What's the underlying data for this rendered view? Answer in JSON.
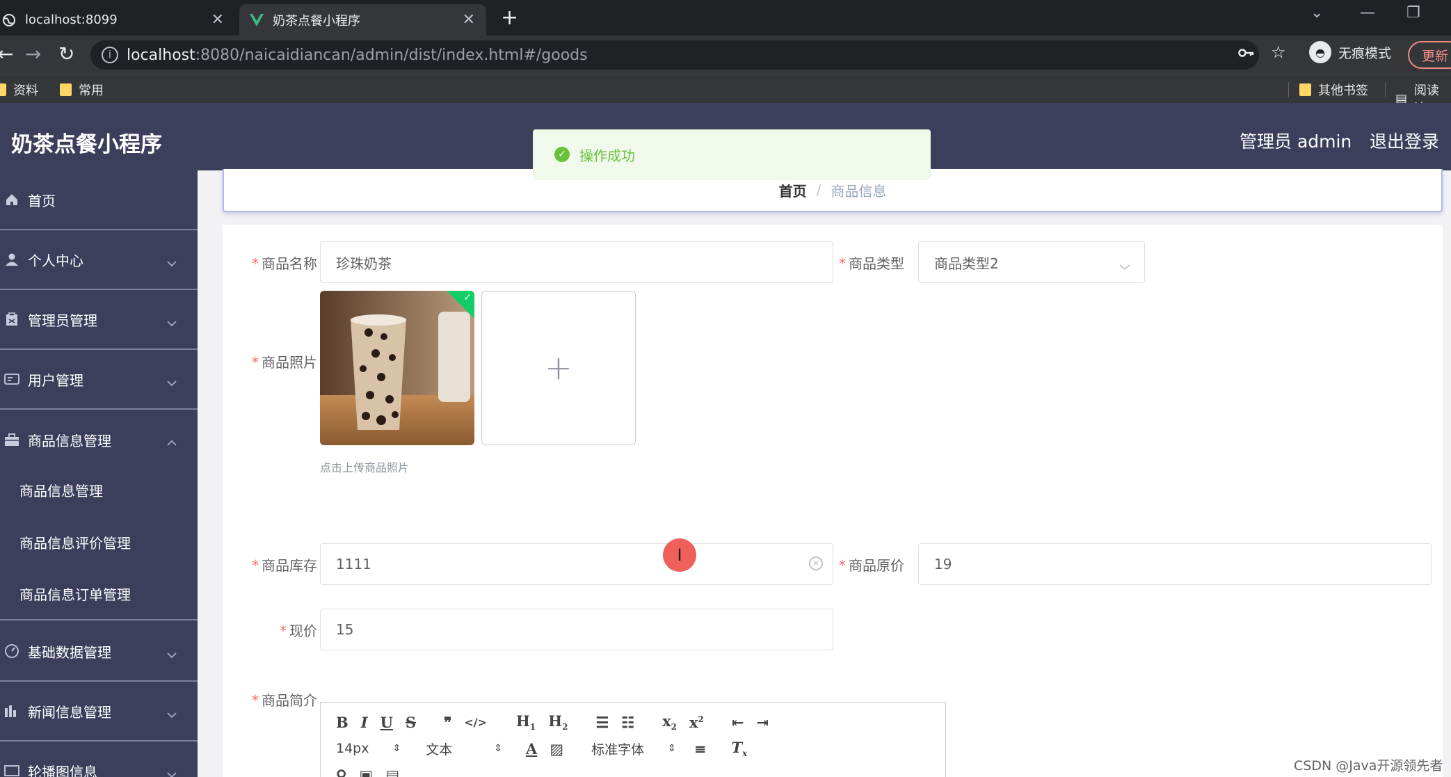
{
  "browser": {
    "tabs": [
      {
        "label": "localhost:8099"
      },
      {
        "label": "奶茶点餐小程序"
      }
    ],
    "url_host": "localhost",
    "url_path": ":8080/naicaidiancan/admin/dist/index.html#/goods",
    "incognito_label": "无痕模式",
    "update_label": "更新",
    "bookmarks": [
      "资料",
      "常用"
    ],
    "other_bookmarks": "其他书签",
    "reading_list": "阅读清"
  },
  "header": {
    "title": "奶茶点餐小程序",
    "admin_label": "管理员 admin",
    "logout_label": "退出登录"
  },
  "toast": {
    "message": "操作成功"
  },
  "sidebar": {
    "items": [
      {
        "label": "首页"
      },
      {
        "label": "个人中心"
      },
      {
        "label": "管理员管理"
      },
      {
        "label": "用户管理"
      },
      {
        "label": "商品信息管理"
      },
      {
        "label": "基础数据管理"
      },
      {
        "label": "新闻信息管理"
      },
      {
        "label": "轮播图信息"
      }
    ],
    "subitems": [
      {
        "label": "商品信息管理"
      },
      {
        "label": "商品信息评价管理"
      },
      {
        "label": "商品信息订单管理"
      }
    ]
  },
  "breadcrumb": {
    "home": "首页",
    "separator": "/",
    "current": "商品信息"
  },
  "form": {
    "name_label": "商品名称",
    "name_value": "珍珠奶茶",
    "type_label": "商品类型",
    "type_value": "商品类型2",
    "photo_label": "商品照片",
    "photo_tip": "点击上传商品照片",
    "stock_label": "商品库存",
    "stock_value": "1111",
    "orig_price_label": "商品原价",
    "orig_price_value": "19",
    "price_label": "现价",
    "price_value": "15",
    "intro_label": "商品简介"
  },
  "editor": {
    "font_size": "14px",
    "header_picker": "文本",
    "font_picker": "标准字体"
  },
  "watermark": "CSDN @Java开源领先者"
}
